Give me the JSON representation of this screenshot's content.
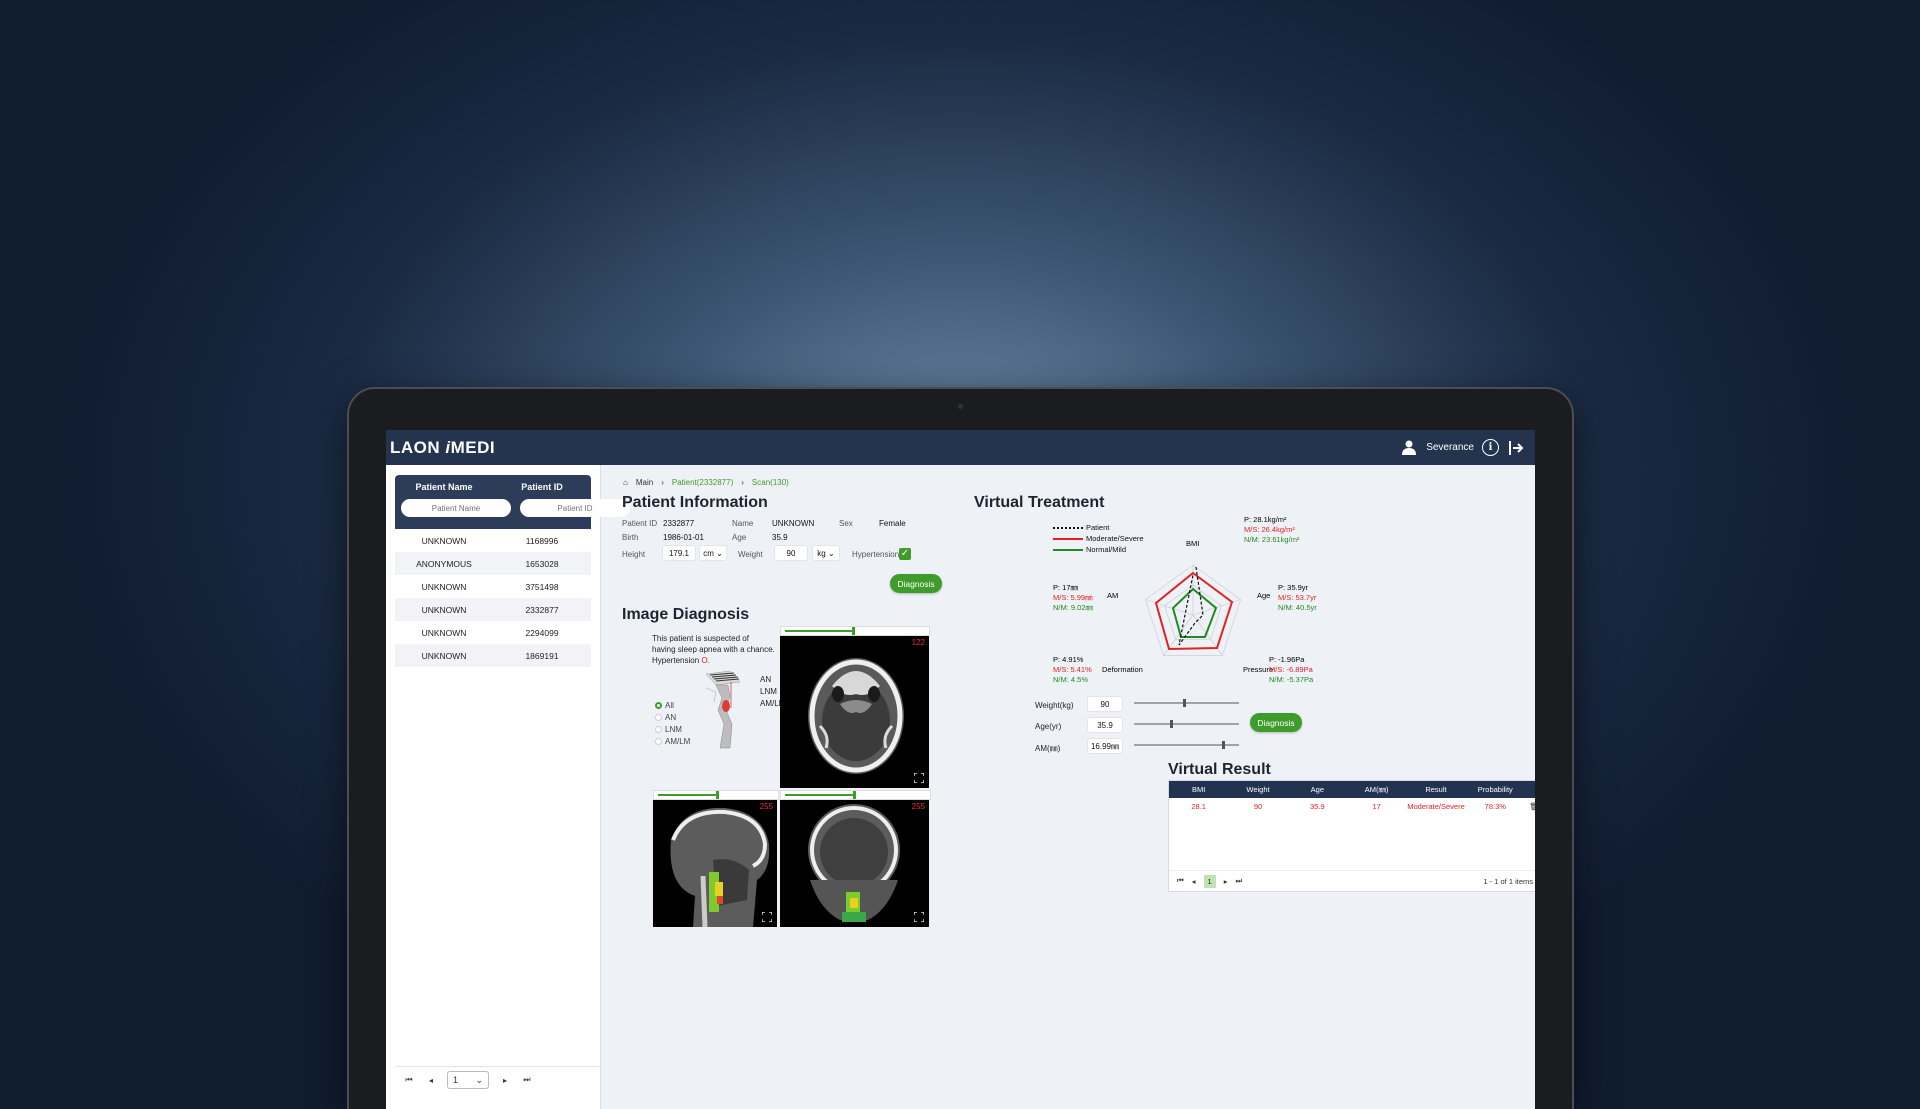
{
  "app": {
    "logo_main": "LAON ",
    "logo_i": "i",
    "logo_tail": "MEDI",
    "user": "Severance"
  },
  "patient_list": {
    "col_name": "Patient Name",
    "col_id": "Patient ID",
    "filter_name_placeholder": "Patient Name",
    "filter_id_placeholder": "Patient ID",
    "rows": [
      {
        "name": "UNKNOWN",
        "id": "1168996"
      },
      {
        "name": "ANONYMOUS",
        "id": "1653028"
      },
      {
        "name": "UNKNOWN",
        "id": "3751498"
      },
      {
        "name": "UNKNOWN",
        "id": "2332877"
      },
      {
        "name": "UNKNOWN",
        "id": "2294099"
      },
      {
        "name": "UNKNOWN",
        "id": "1869191"
      }
    ],
    "page": "1"
  },
  "breadcrumb": {
    "main": "Main",
    "patient": "Patient(2332877)",
    "scan": "Scan(130)"
  },
  "patient_info": {
    "title": "Patient Information",
    "id_label": "Patient ID",
    "id_value": "2332877",
    "name_label": "Name",
    "name_value": "UNKNOWN",
    "sex_label": "Sex",
    "sex_value": "Female",
    "birth_label": "Birth",
    "birth_value": "1986-01-01",
    "age_label": "Age",
    "age_value": "35.9",
    "height_label": "Height",
    "height_value": "179.1",
    "height_unit": "cm",
    "weight_label": "Weight",
    "weight_value": "90",
    "weight_unit": "kg",
    "hypertension_label": "Hypertension",
    "diagnosis_button": "Diagnosis"
  },
  "image_diagnosis": {
    "title": "Image Diagnosis",
    "message_line1": "This patient is suspected of",
    "message_line2": "having sleep apnea with a chance.",
    "message_line3": "Hypertension",
    "message_mark": "O.",
    "airway_labels": [
      "AN",
      "LNM",
      "AM/LM"
    ],
    "filter_options": [
      "All",
      "AN",
      "LNM",
      "AM/LM"
    ],
    "selected_filter": "All",
    "views": [
      {
        "index": "122",
        "slider": 0.48
      },
      {
        "index": "255",
        "slider": 0.5
      },
      {
        "index": "255",
        "slider": 0.48
      }
    ]
  },
  "virtual_treatment": {
    "title": "Virtual Treatment",
    "legend": {
      "patient": "Patient",
      "moderate": "Moderate/Severe",
      "normal": "Normal/Mild"
    },
    "axes": [
      "BMI",
      "Age",
      "Pressure",
      "Deformation",
      "AM"
    ],
    "bmi": {
      "p": "P: 28.1kg/m²",
      "ms": "M/S: 26.4kg/m²",
      "nm": "N/M: 23.61kg/m²"
    },
    "age": {
      "p": "P: 35.9yr",
      "ms": "M/S: 53.7yr",
      "nm": "N/M: 40.5yr"
    },
    "pressure": {
      "p": "P: -1.96Pa",
      "ms": "M/S: -6.89Pa",
      "nm": "N/M: -5.37Pa"
    },
    "deformation": {
      "p": "P: 4.91%",
      "ms": "M/S: 5.41%",
      "nm": "N/M: 4.5%"
    },
    "am": {
      "p": "P: 17㎜",
      "ms": "M/S: 5.99㎜",
      "nm": "N/M: 9.02㎜"
    },
    "colors": {
      "moderate": "#e02222",
      "normal": "#1f8a1f",
      "patient": "#111111"
    },
    "sim": [
      {
        "label": "Weight(kg)",
        "value": "90",
        "level": 0.48
      },
      {
        "label": "Age(yr)",
        "value": "35.9",
        "level": 0.35
      },
      {
        "label": "AM(㎜)",
        "value": "16.99㎜",
        "level": 0.85
      }
    ],
    "diagnosis_button": "Diagnosis"
  },
  "virtual_result": {
    "title": "Virtual Result",
    "columns": [
      "BMI",
      "Weight",
      "Age",
      "AM(㎜)",
      "Result",
      "Probability"
    ],
    "rows": [
      {
        "bmi": "28.1",
        "weight": "90",
        "age": "35.9",
        "am": "17",
        "result": "Moderate/Severe",
        "probability": "78.3%"
      }
    ],
    "page": "1",
    "summary": "1 - 1 of 1 items"
  }
}
